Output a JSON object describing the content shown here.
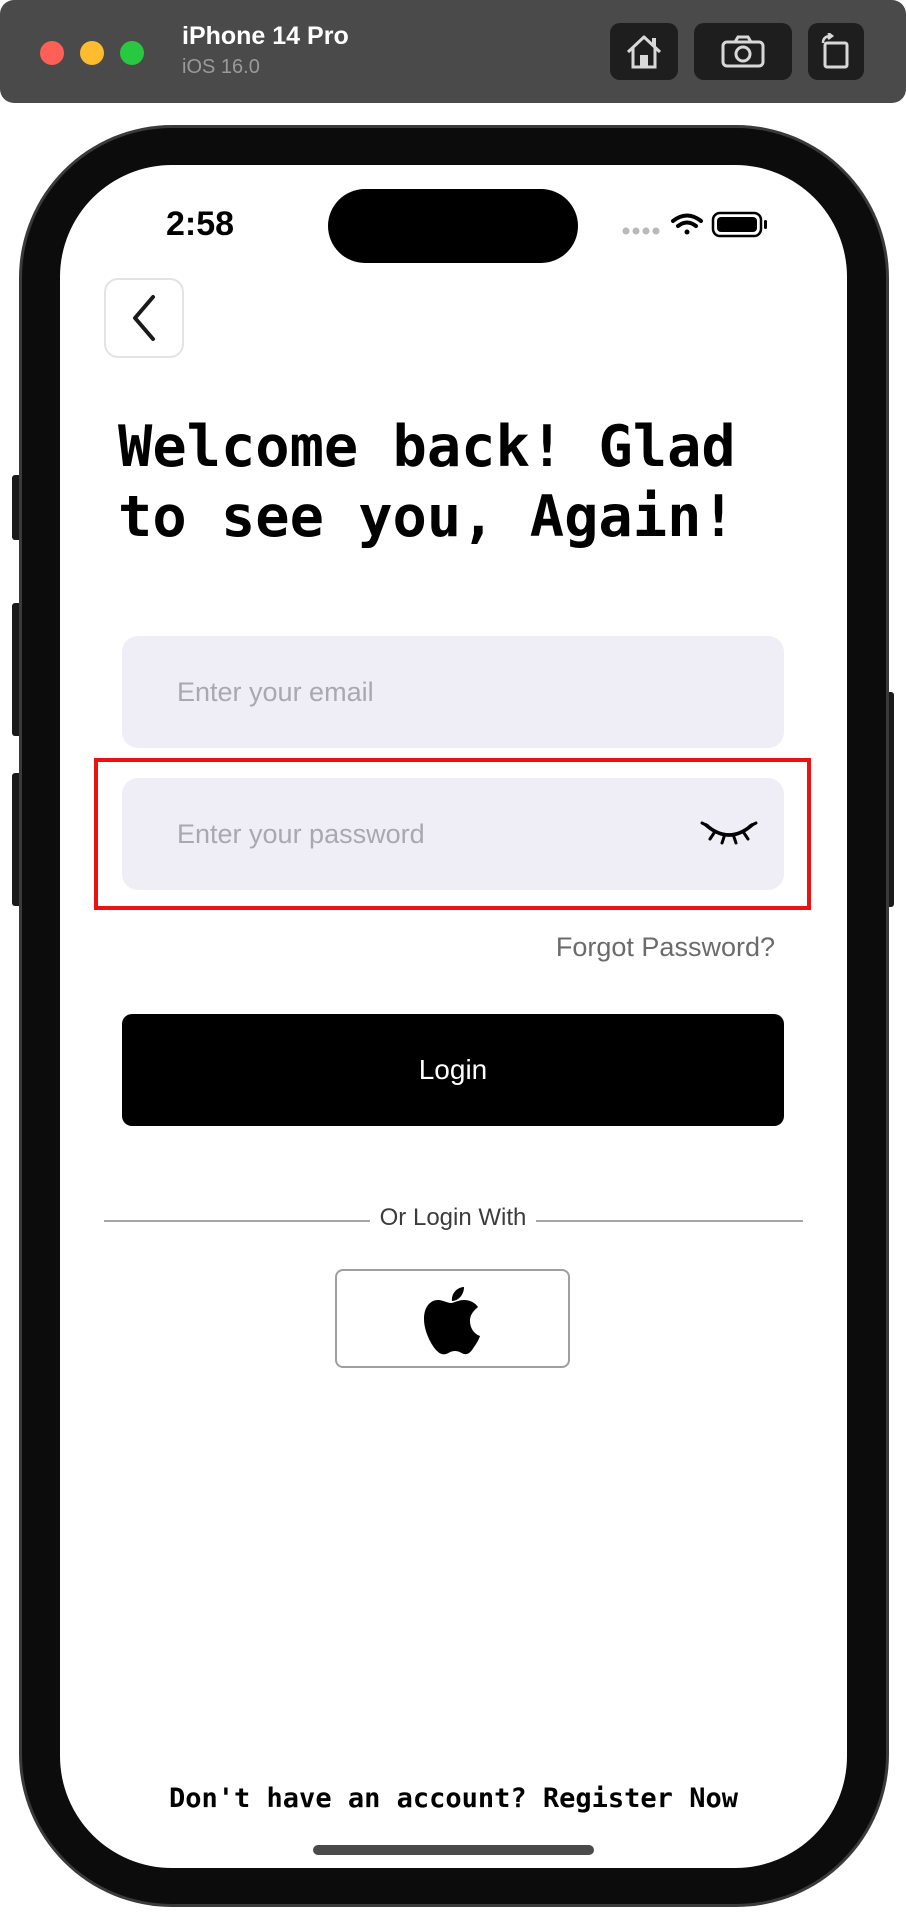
{
  "simulator": {
    "device_name": "iPhone 14 Pro",
    "os_version": "iOS 16.0",
    "buttons": [
      "home-icon",
      "screenshot-icon",
      "rotate-icon"
    ]
  },
  "status_bar": {
    "time": "2:58",
    "icons": [
      "signal-dots-icon",
      "wifi-icon",
      "battery-icon"
    ]
  },
  "login": {
    "headline": "Welcome back! Glad\nto see you, Again!",
    "email_placeholder": "Enter your email",
    "password_placeholder": "Enter your password",
    "forgot_password": "Forgot Password?",
    "login_button": "Login",
    "divider_text": "Or Login With",
    "social": [
      "apple-logo-icon"
    ],
    "footer_text": "Don't have an account? Register Now"
  },
  "colors": {
    "field_bg": "#efeef6",
    "primary_button": "#000000",
    "highlight_box": "#ee1111"
  }
}
